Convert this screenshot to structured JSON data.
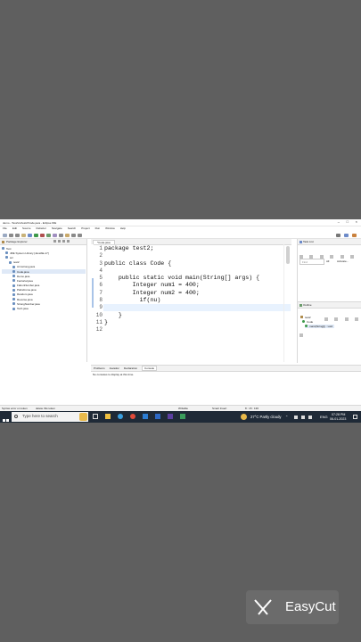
{
  "window": {
    "title": "demo - Test/src/test2/Code.java - Eclipse IDE"
  },
  "menu": [
    "File",
    "Edit",
    "Source",
    "Refactor",
    "Navigate",
    "Search",
    "Project",
    "Run",
    "Window",
    "Help"
  ],
  "package_explorer": {
    "title": "Package Explorer",
    "items": [
      {
        "label": "Test",
        "level": 0
      },
      {
        "label": "JRE System Library [JavaSE-17]",
        "level": 1
      },
      {
        "label": "src",
        "level": 1
      },
      {
        "label": "test2",
        "level": 2
      },
      {
        "label": "Armstrong.java",
        "level": 3
      },
      {
        "label": "Code.java",
        "level": 3,
        "selected": true
      },
      {
        "label": "Demo.java",
        "level": 3
      },
      {
        "label": "Factorial.java",
        "level": 3
      },
      {
        "label": "FabonNumber.java",
        "level": 3
      },
      {
        "label": "Palindrome.java",
        "level": 3
      },
      {
        "label": "Random.java",
        "level": 3
      },
      {
        "label": "Reverse.java",
        "level": 3
      },
      {
        "label": "StrongNumber.java",
        "level": 3
      },
      {
        "label": "Tech.java",
        "level": 3
      }
    ]
  },
  "editor": {
    "tab": "*Code.java",
    "line_numbers": [
      "1",
      "2",
      "3",
      "4",
      "5",
      "6",
      "7",
      "8",
      "9",
      "10",
      "11",
      "12"
    ],
    "lines": [
      "package test2;",
      "",
      "public class Code {",
      "",
      "    public static void main(String[] args) {",
      "        Integer num1 = 400;",
      "        Integer num2 = 400;",
      "          if(nu)",
      "",
      "    }",
      "}",
      ""
    ]
  },
  "task_list": {
    "title": "Task List",
    "find_placeholder": "Find",
    "all": "All",
    "activate": "Activate..."
  },
  "outline": {
    "title": "Outline",
    "items": [
      "test2",
      "Code",
      "main(String[]) : void"
    ]
  },
  "bottom_panel": {
    "tabs": [
      "Problems",
      "Javadoc",
      "Declaration",
      "Console"
    ],
    "message": "No consoles to display at this time."
  },
  "status_bar": {
    "left": "Syntax error on token",
    "left2": "delete this token",
    "writable": "Writable",
    "insert_mode": "Smart Insert",
    "position": "8 : 15 : 136"
  },
  "taskbar": {
    "search_placeholder": "Type here to search",
    "weather": "27°C  Partly cloudy",
    "language": "ENG",
    "time": "07:28 PM",
    "date": "06-01-2023"
  },
  "watermark": {
    "text": "EasyCut"
  }
}
